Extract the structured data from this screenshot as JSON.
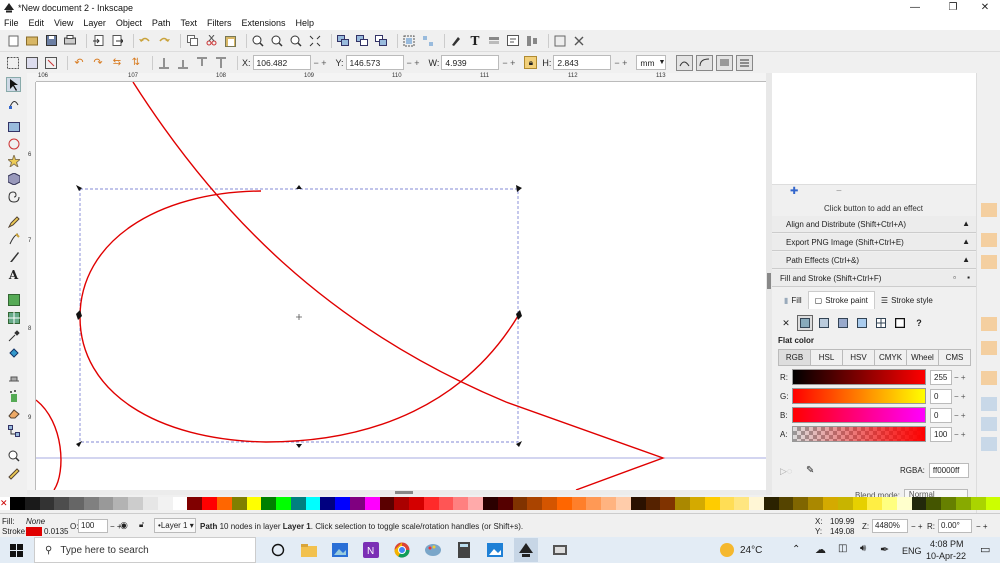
{
  "window": {
    "title": "*New document 2 - Inkscape"
  },
  "menu": [
    "File",
    "Edit",
    "View",
    "Layer",
    "Object",
    "Path",
    "Text",
    "Filters",
    "Extensions",
    "Help"
  ],
  "controls": {
    "x_label": "X:",
    "x_value": "106.482",
    "y_label": "Y:",
    "y_value": "146.573",
    "w_label": "W:",
    "w_value": "4.939",
    "h_label": "H:",
    "h_value": "2.843",
    "unit": "mm"
  },
  "ruler": {
    "h_ticks": [
      "106",
      "107",
      "108",
      "109",
      "110",
      "111",
      "112",
      "113"
    ],
    "v_ticks": [
      "6",
      "7",
      "8",
      "9"
    ]
  },
  "panel": {
    "effects_hint": "Click button to add an effect",
    "align": "Align and Distribute (Shift+Ctrl+A)",
    "export": "Export PNG Image (Shift+Ctrl+E)",
    "path_effects": "Path Effects (Ctrl+&)",
    "fill_stroke": "Fill and Stroke (Shift+Ctrl+F)",
    "tabs": {
      "fill": "Fill",
      "stroke_paint": "Stroke paint",
      "stroke_style": "Stroke style"
    },
    "flat_color": "Flat color",
    "color_modes": [
      "RGB",
      "HSL",
      "HSV",
      "CMYK",
      "Wheel",
      "CMS"
    ],
    "channels": [
      {
        "name": "R:",
        "value": "255"
      },
      {
        "name": "G:",
        "value": "0"
      },
      {
        "name": "B:",
        "value": "0"
      },
      {
        "name": "A:",
        "value": "100"
      }
    ],
    "rgba_label": "RGBA:",
    "rgba_value": "ff0000ff",
    "blend_label": "Blend mode:",
    "blend_value": "Normal"
  },
  "status": {
    "fill_label": "Fill:",
    "fill_value": "None",
    "stroke_label": "Stroke:",
    "stroke_width": "0.0135",
    "opacity_label": "O:",
    "opacity_value": "100",
    "layer": "Layer 1",
    "msg_bold": "Path",
    "msg_mid": " 10 nodes in layer ",
    "msg_layer": "Layer 1",
    "msg_end": ". Click selection to toggle scale/rotation handles (or Shift+s).",
    "cursor_x_label": "X:",
    "cursor_x": "109.99",
    "cursor_y_label": "Y:",
    "cursor_y": "149.08",
    "zoom_label": "Z:",
    "zoom": "4480%",
    "rotate_label": "R:",
    "rotate": "0.00°"
  },
  "taskbar": {
    "search_placeholder": "Type here to search",
    "temp": "24°C",
    "lang": "ENG",
    "time": "4:08 PM",
    "date": "10-Apr-22"
  },
  "colors": {
    "stroke_red": "#e00000",
    "selection": "#5b63c9",
    "guide": "#8a8fd6"
  }
}
